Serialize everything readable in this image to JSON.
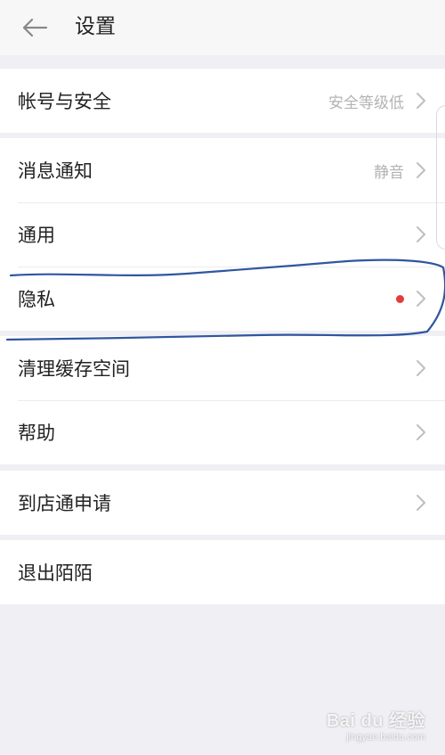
{
  "header": {
    "title": "设置",
    "back_icon": "arrow-left-icon"
  },
  "groups": [
    {
      "items": [
        {
          "label": "帐号与安全",
          "value": "安全等级低",
          "chevron": true
        }
      ]
    },
    {
      "items": [
        {
          "label": "消息通知",
          "value": "静音",
          "chevron": true
        },
        {
          "label": "通用",
          "value": "",
          "chevron": true
        },
        {
          "label": "隐私",
          "value": "",
          "badge": "red-dot",
          "chevron": true
        }
      ]
    },
    {
      "items": [
        {
          "label": "清理缓存空间",
          "value": "",
          "chevron": true
        },
        {
          "label": "帮助",
          "value": "",
          "chevron": true
        }
      ]
    },
    {
      "items": [
        {
          "label": "到店通申请",
          "value": "",
          "chevron": true
        }
      ]
    },
    {
      "items": [
        {
          "label": "退出陌陌",
          "value": "",
          "chevron": false
        }
      ]
    }
  ],
  "colors": {
    "background": "#efeff4",
    "badge": "#e53b3b",
    "annotation": "#2f56a0",
    "chevron": "#bfbfbf"
  },
  "watermark": {
    "main": "Bai du 经验",
    "sub": "jingyan.baidu.com"
  }
}
